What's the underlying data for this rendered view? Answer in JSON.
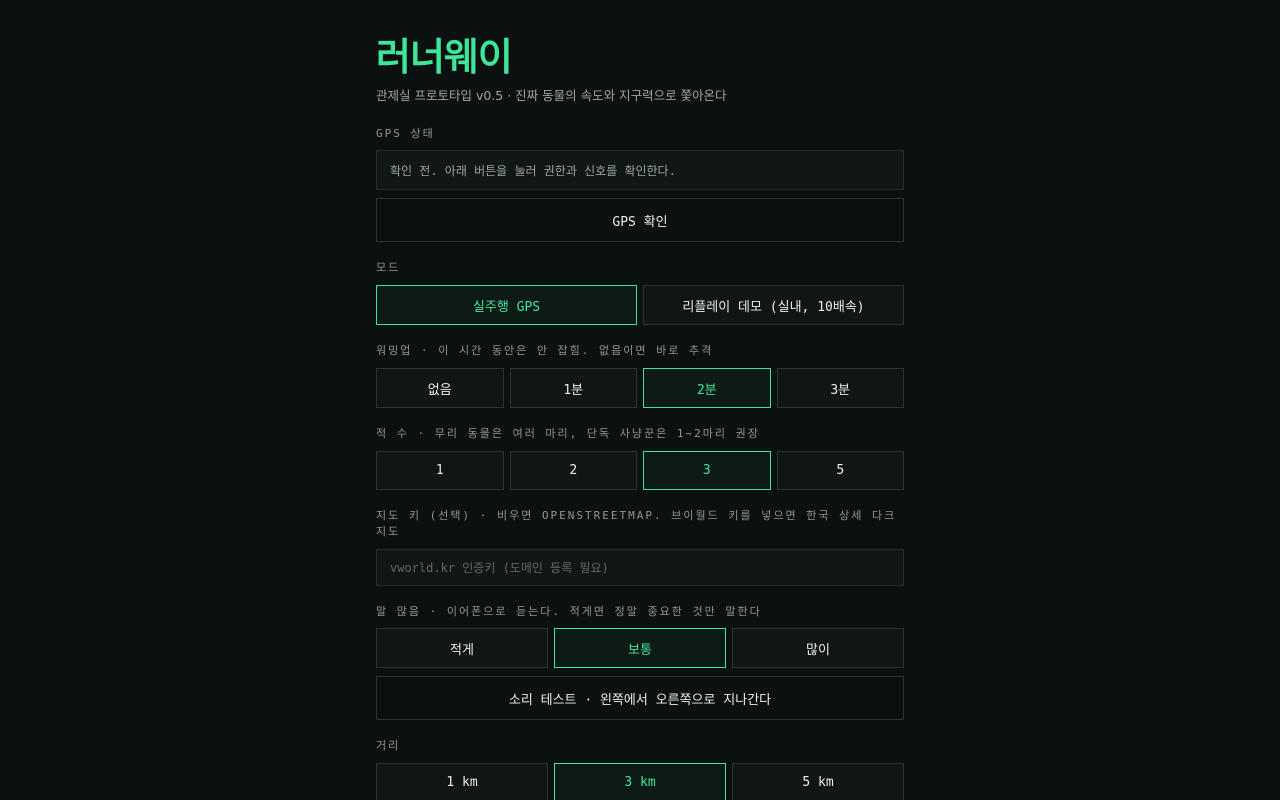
{
  "header": {
    "title": "러너웨이",
    "subtitle": "관제실 프로토타입 v0.5 · 진짜 동물의 속도와 지구력으로 쫓아온다"
  },
  "gps": {
    "label": "GPS 상태",
    "status": "확인 전. 아래 버튼을 눌러 권한과 신호를 확인한다.",
    "check_button": "GPS 확인"
  },
  "mode": {
    "label": "모드",
    "options": [
      "실주행 GPS",
      "리플레이 데모 (실내, 10배속)"
    ],
    "selected": "실주행 GPS"
  },
  "warmup": {
    "label": "워밍업 · 이 시간 동안은 안 잡힘. 없음이면 바로 추격",
    "options": [
      "없음",
      "1분",
      "2분",
      "3분"
    ],
    "selected": "2분"
  },
  "enemies": {
    "label": "적 수 · 무리 동물은 여러 마리, 단독 사냥꾼은 1~2마리 권장",
    "options": [
      "1",
      "2",
      "3",
      "5"
    ],
    "selected": "3"
  },
  "map_key": {
    "label": "지도 키 (선택) · 비우면 OPENSTREETMAP. 브이월드 키를 넣으면 한국 상세 다크 지도",
    "placeholder": "vworld.kr 인증키 (도메인 등록 필요)",
    "value": ""
  },
  "voice": {
    "label": "말 많음 · 이어폰으로 듣는다. 적게면 정말 중요한 것만 말한다",
    "options": [
      "적게",
      "보통",
      "많이"
    ],
    "selected": "보통",
    "sound_test_button": "소리 테스트 · 왼쪽에서 오른쪽으로 지나간다"
  },
  "distance": {
    "label": "거리",
    "options": [
      "1 km",
      "3 km",
      "5 km"
    ],
    "selected": "3 km"
  },
  "colors": {
    "accent": "#3ee69a",
    "background": "#0b1110"
  }
}
